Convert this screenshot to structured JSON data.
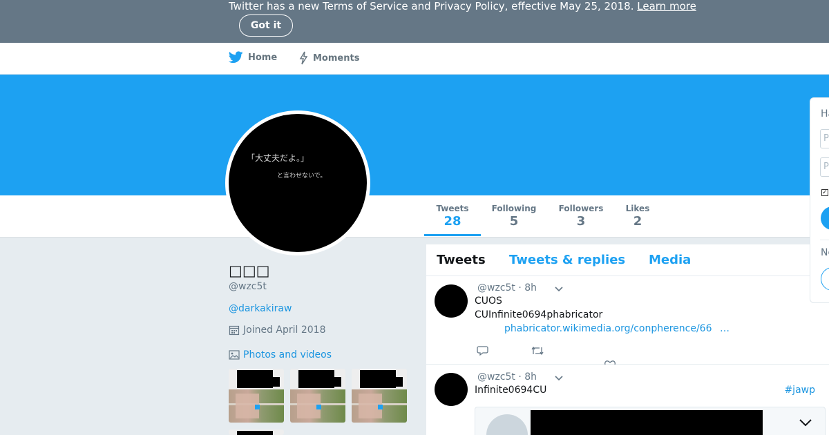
{
  "banner": {
    "text": "Twitter has a new Terms of Service and Privacy Policy, effective May 25, 2018.",
    "link_label": "Learn more",
    "button_label": "Got it"
  },
  "nav": {
    "home_label": "Home",
    "moments_label": "Moments"
  },
  "profile": {
    "display_name": "□□□",
    "screen_name": "@wzc5t",
    "bio_link": "@darkakiraw",
    "joined": "Joined April 2018",
    "photos_label": "Photos and videos",
    "avatar_text_1": "「大丈夫だよ。」",
    "avatar_text_2": "と言わせないで。"
  },
  "stats": [
    {
      "label": "Tweets",
      "value": "28"
    },
    {
      "label": "Following",
      "value": "5"
    },
    {
      "label": "Followers",
      "value": "3"
    },
    {
      "label": "Likes",
      "value": "2"
    }
  ],
  "timeline": {
    "tabs": [
      "Tweets",
      "Tweets & replies",
      "Media"
    ],
    "tweets": [
      {
        "handle": "@wzc5t",
        "time": "· 8h",
        "line1": "CUOS",
        "line2": "CUInfinite0694phabricator",
        "link": "phabricator.wikimedia.org/conpherence/66",
        "ellipsis": "…"
      },
      {
        "handle": "@wzc5t",
        "time": "· 8h",
        "line1": "Infinite0694CU",
        "hashtag": "#jawp"
      }
    ]
  },
  "login": {
    "heading_fragment": "Ha",
    "input1_fragment": "P",
    "input2_fragment": "P",
    "new_fragment": "Ne"
  },
  "colors": {
    "brand": "#1da1f2",
    "banner": "#657786",
    "link": "#1b95e0"
  }
}
